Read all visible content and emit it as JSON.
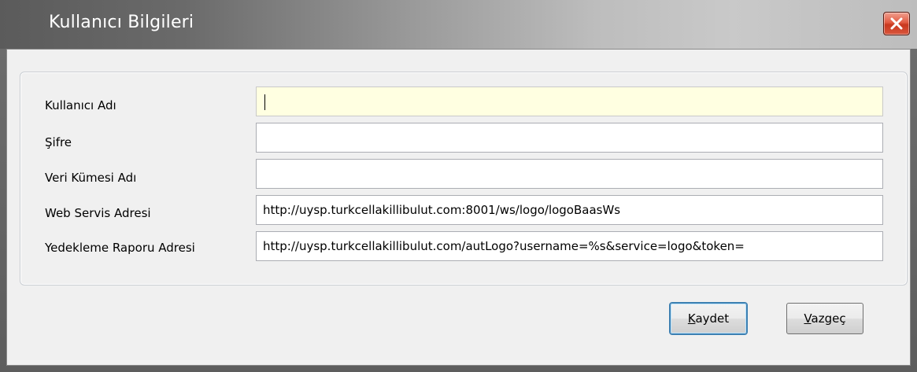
{
  "window": {
    "title": "Kullanıcı Bilgileri"
  },
  "form": {
    "fields": [
      {
        "label": "Kullanıcı Adı",
        "value": ""
      },
      {
        "label": "Şifre",
        "value": ""
      },
      {
        "label": "Veri Kümesi Adı",
        "value": ""
      },
      {
        "label": "Web Servis Adresi",
        "value": "http://uysp.turkcellakillibulut.com:8001/ws/logo/logoBaasWs"
      },
      {
        "label": "Yedekleme Raporu Adresi",
        "value": "http://uysp.turkcellakillibulut.com/autLogo?username=%s&service=logo&token="
      }
    ]
  },
  "buttons": {
    "save_mnemonic": "K",
    "save_rest": "aydet",
    "cancel_mnemonic": "V",
    "cancel_rest": "azgeç"
  },
  "colors": {
    "focused_field_bg": "#ffffe1",
    "close_button": "#d9563c",
    "default_button_border": "#3c7fb1"
  },
  "icons": {
    "close": "close-x-icon"
  }
}
